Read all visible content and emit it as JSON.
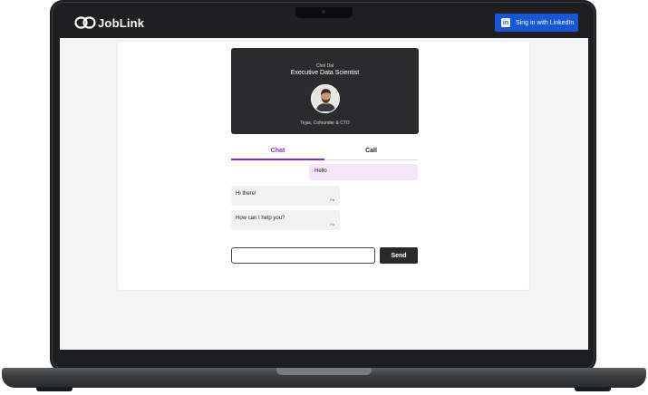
{
  "header": {
    "brand": "JobLink",
    "linkedin_label": "Sing in with LinkedIn",
    "linkedin_icon": "in"
  },
  "profile": {
    "name": "Chol Dal",
    "title": "Executive Data Scientist",
    "subtitle": "Tejas, Cofounder & CTO"
  },
  "tabs": [
    {
      "label": "Chat",
      "active": true
    },
    {
      "label": "Call",
      "active": false
    }
  ],
  "messages": [
    {
      "text": "Hello",
      "direction": "outgoing",
      "sender": ""
    },
    {
      "text": "Hi there!",
      "direction": "incoming",
      "sender": "Fa"
    },
    {
      "text": "How can I help you?",
      "direction": "incoming",
      "sender": "Fa"
    }
  ],
  "composer": {
    "placeholder": "",
    "send_label": "Send"
  },
  "colors": {
    "accent": "#8c2bc2",
    "linkedin": "#1856d6",
    "topbar": "#1f1f21",
    "outgoing_bubble": "#f6e6f9"
  }
}
